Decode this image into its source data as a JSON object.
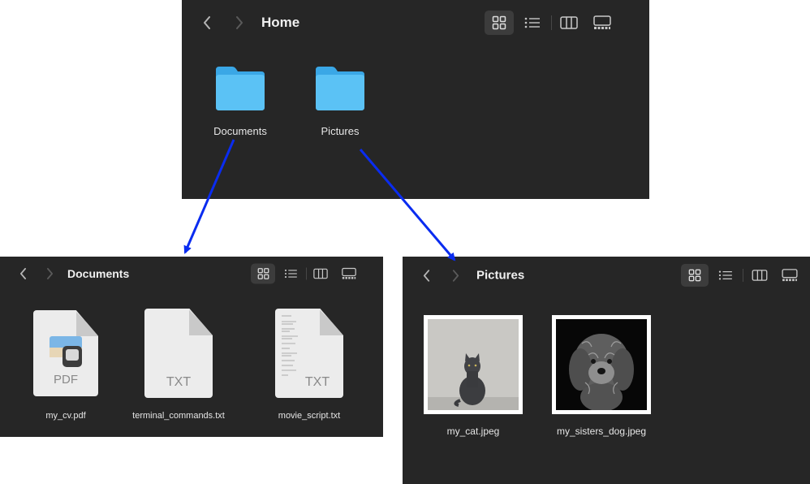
{
  "home_window": {
    "title": "Home",
    "items": [
      {
        "label": "Documents",
        "icon": "folder-icon"
      },
      {
        "label": "Pictures",
        "icon": "folder-icon"
      }
    ]
  },
  "documents_window": {
    "title": "Documents",
    "items": [
      {
        "label": "my_cv.pdf",
        "ext": "PDF",
        "icon": "pdf-file-icon"
      },
      {
        "label": "terminal_commands.txt",
        "ext": "TXT",
        "icon": "txt-file-icon"
      },
      {
        "label": "movie_script.txt",
        "ext": "TXT",
        "icon": "txt-file-icon"
      }
    ]
  },
  "pictures_window": {
    "title": "Pictures",
    "items": [
      {
        "label": "my_cat.jpeg",
        "icon": "cat-photo-thumbnail"
      },
      {
        "label": "my_sisters_dog.jpeg",
        "icon": "dog-photo-thumbnail"
      }
    ]
  },
  "colors": {
    "window_bg": "#262626",
    "folder": "#5bc2f5",
    "arrow": "#0a2cf0"
  }
}
